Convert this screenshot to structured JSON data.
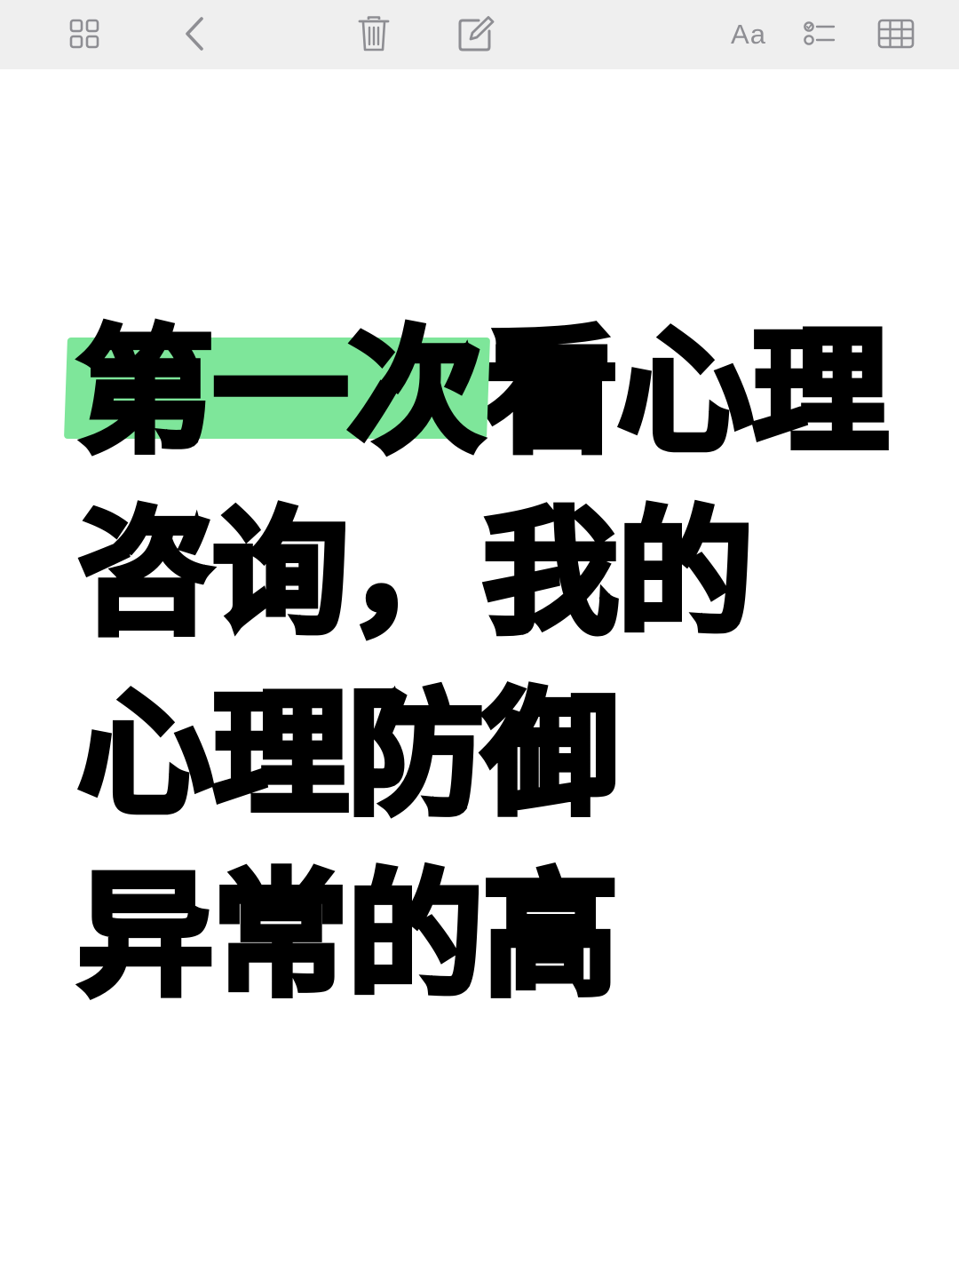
{
  "toolbar": {
    "text_format_label": "Aa"
  },
  "note": {
    "title_lines": [
      {
        "highlight": "第一次",
        "rest": "看心理"
      },
      {
        "highlight": "",
        "rest": "咨询，我的"
      },
      {
        "highlight": "",
        "rest": "心理防御"
      },
      {
        "highlight": "",
        "rest": "异常的高"
      }
    ]
  },
  "colors": {
    "toolbar_bg": "#efefef",
    "icon_gray": "#8e8e93",
    "highlight_green": "#7ee69a",
    "text": "#000000"
  },
  "icons": [
    "gallery-grid-icon",
    "back-chevron-icon",
    "trash-icon",
    "compose-icon",
    "text-format-icon",
    "checklist-icon",
    "table-icon"
  ]
}
